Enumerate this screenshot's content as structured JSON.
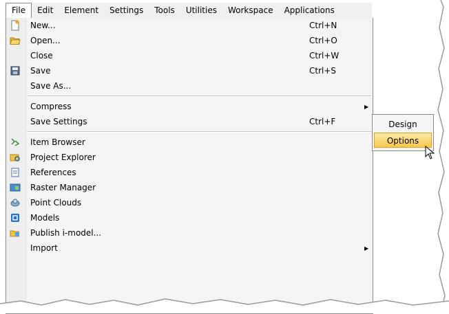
{
  "menubar": {
    "items": [
      "File",
      "Edit",
      "Element",
      "Settings",
      "Tools",
      "Utilities",
      "Workspace",
      "Applications"
    ]
  },
  "file_menu": {
    "items": [
      {
        "label": "New...",
        "shortcut": "Ctrl+N",
        "icon": "new-file-icon"
      },
      {
        "label": "Open...",
        "shortcut": "Ctrl+O",
        "icon": "folder-open-icon"
      },
      {
        "label": "Close",
        "shortcut": "Ctrl+W",
        "icon": ""
      },
      {
        "label": "Save",
        "shortcut": "Ctrl+S",
        "icon": "floppy-disk-icon"
      },
      {
        "label": "Save As...",
        "shortcut": "",
        "icon": ""
      },
      {
        "label": "Compress",
        "shortcut": "",
        "icon": "",
        "submenu": true
      },
      {
        "label": "Save Settings",
        "shortcut": "Ctrl+F",
        "icon": ""
      },
      {
        "label": "Item Browser",
        "shortcut": "",
        "icon": "item-browser-icon"
      },
      {
        "label": "Project Explorer",
        "shortcut": "",
        "icon": "project-explorer-icon"
      },
      {
        "label": "References",
        "shortcut": "",
        "icon": "references-icon"
      },
      {
        "label": "Raster Manager",
        "shortcut": "",
        "icon": "raster-manager-icon"
      },
      {
        "label": "Point Clouds",
        "shortcut": "",
        "icon": "point-clouds-icon"
      },
      {
        "label": "Models",
        "shortcut": "",
        "icon": "models-icon"
      },
      {
        "label": "Publish i-model...",
        "shortcut": "",
        "icon": "publish-imodel-icon"
      },
      {
        "label": "Import",
        "shortcut": "",
        "icon": "",
        "submenu": true
      }
    ]
  },
  "compress_submenu": {
    "items": [
      "Design",
      "Options"
    ],
    "highlighted": "Options"
  },
  "colors": {
    "highlight": "#f7c84c",
    "menu_bg": "#f5f5f5"
  }
}
